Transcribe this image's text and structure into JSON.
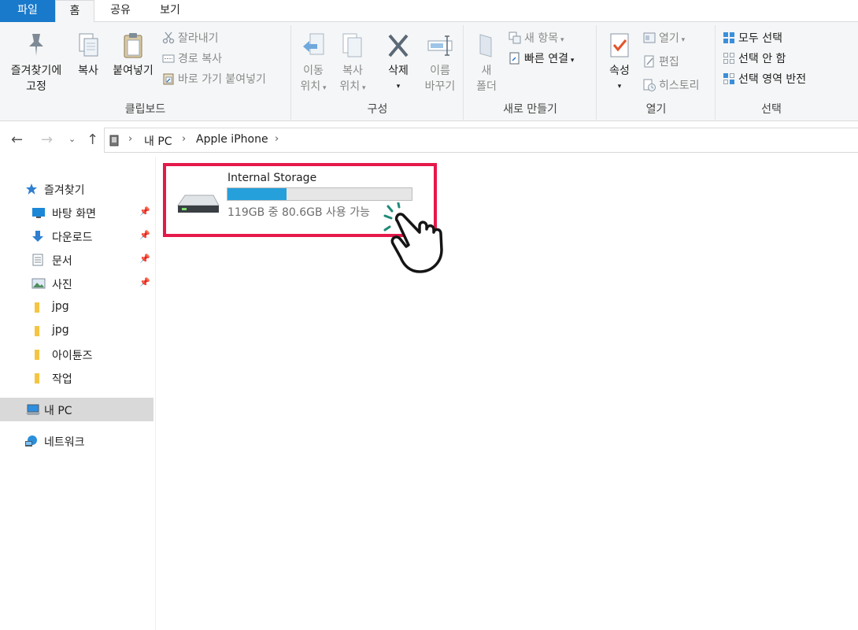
{
  "tabs": [
    {
      "label": "파일"
    },
    {
      "label": "홈"
    },
    {
      "label": "공유"
    },
    {
      "label": "보기"
    }
  ],
  "ribbon": {
    "clipboard": {
      "label": "클립보드",
      "pin_quick_access": [
        "즐겨찾기에",
        "고정"
      ],
      "copy": "복사",
      "paste": "붙여넣기",
      "cut": "잘라내기",
      "copy_path": "경로 복사",
      "paste_shortcut": "바로 가기 붙여넣기"
    },
    "organize": {
      "label": "구성",
      "move_to": [
        "이동",
        "위치"
      ],
      "copy_to": [
        "복사",
        "위치"
      ],
      "delete": "삭제",
      "rename": [
        "이름",
        "바꾸기"
      ]
    },
    "new": {
      "label": "새로 만들기",
      "new_folder": [
        "새",
        "폴더"
      ],
      "new_item": "새 항목",
      "easy_access": "빠른 연결"
    },
    "open": {
      "label": "열기",
      "properties": "속성",
      "open": "열기",
      "edit": "편집",
      "history": "히스토리"
    },
    "select": {
      "label": "선택",
      "select_all": "모두 선택",
      "select_none": "선택 안 함",
      "invert": "선택 영역 반전"
    }
  },
  "address": {
    "crumbs": [
      "내 PC",
      "Apple iPhone"
    ]
  },
  "sidebar": {
    "quick_access": "즐겨찾기",
    "items": [
      {
        "label": "바탕 화면",
        "pinned": true
      },
      {
        "label": "다운로드",
        "pinned": true
      },
      {
        "label": "문서",
        "pinned": true
      },
      {
        "label": "사진",
        "pinned": true
      },
      {
        "label": "jpg",
        "pinned": false
      },
      {
        "label": "jpg",
        "pinned": false
      },
      {
        "label": "아이튠즈",
        "pinned": false
      },
      {
        "label": "작업",
        "pinned": false
      }
    ],
    "this_pc": "내 PC",
    "network": "네트워크"
  },
  "drive": {
    "name": "Internal Storage",
    "free_text": "119GB 중 80.6GB 사용 가능",
    "used_fraction": 0.32
  },
  "colors": {
    "file_tab": "#1979ca",
    "highlight": "#e5194a",
    "usage_bar": "#26a0da"
  }
}
